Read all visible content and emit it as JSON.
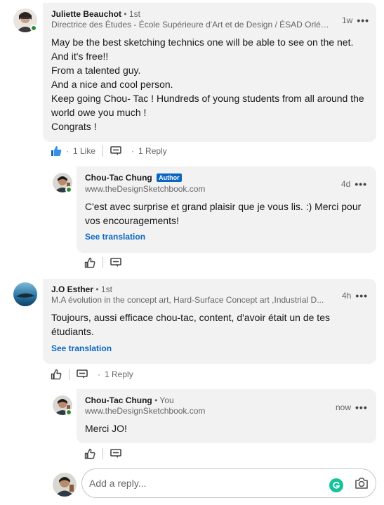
{
  "comments": [
    {
      "author": "Juliette Beauchot",
      "degree": "• 1st",
      "headline": "Directrice des Études - École Supérieure d'Art et de Design / ÉSAD Orléa...",
      "time": "1w",
      "lines": [
        "May be the best sketching technics one will be able to see on the net.",
        "And it's free!!",
        "From a talented guy.",
        "And a nice and cool person.",
        "Keep going Chou- Tac ! Hundreds of young students from all around the",
        "world owe you much !",
        "Congrats !"
      ],
      "likes": "1 Like",
      "replies": "1 Reply",
      "reply": {
        "author": "Chou-Tac Chung",
        "badge": "Author",
        "headline": "www.theDesignSketchbook.com",
        "time": "4d",
        "lines": [
          "C'est avec surprise et grand plaisir que je vous lis. :) Merci pour",
          "vos encouragements!"
        ],
        "see_translation": "See translation"
      }
    },
    {
      "author": "J.O Esther",
      "degree": "• 1st",
      "headline": "M.A évolution in the concept art, Hard-Surface Concept art ,Industrial D...",
      "time": "4h",
      "lines": [
        "Toujours, aussi efficace chou-tac, content, d'avoir était un de tes",
        "étudiants."
      ],
      "see_translation": "See translation",
      "replies": "1 Reply",
      "reply": {
        "author": "Chou-Tac Chung",
        "degree": "• You",
        "headline": "www.theDesignSketchbook.com",
        "time": "now",
        "lines": [
          "Merci JO!"
        ]
      }
    }
  ],
  "reply_box": {
    "placeholder": "Add a reply..."
  },
  "icons": {
    "like": "thumbs-up-icon",
    "reply": "comment-icon",
    "more": "ellipsis-icon",
    "photo": "camera-icon",
    "grammarly": "grammarly-icon"
  },
  "colors": {
    "accent": "#0a66c2",
    "bubble": "#f2f2f2",
    "online": "#2f8a37",
    "grammarly": "#15c39a"
  }
}
